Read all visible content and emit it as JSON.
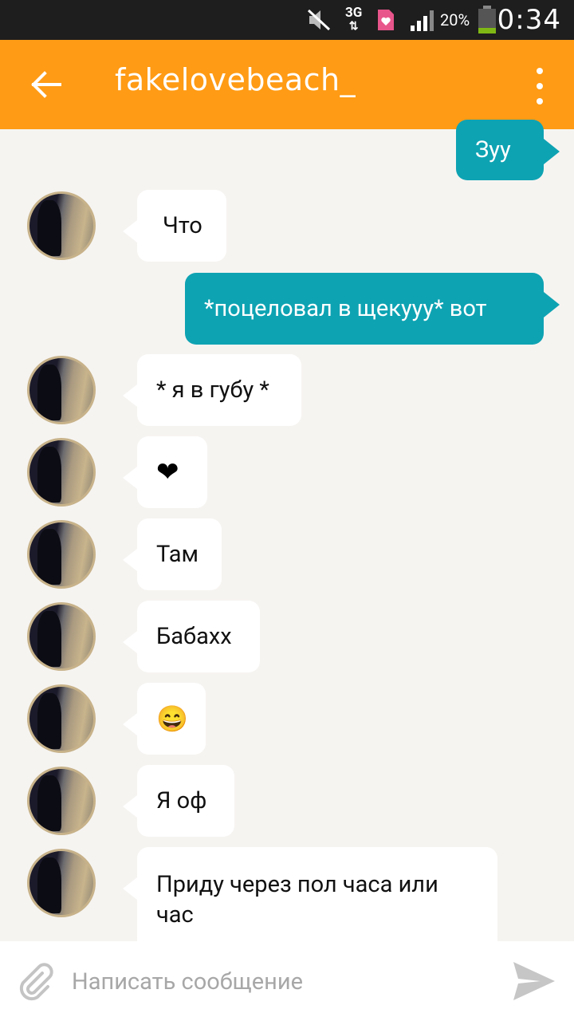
{
  "status_bar": {
    "network": "3G",
    "battery": "20%",
    "time": "0:34"
  },
  "app_bar": {
    "title": "fakelovebeach_"
  },
  "messages": [
    {
      "from": "me",
      "text": "Зуу"
    },
    {
      "from": "them",
      "text": "Что"
    },
    {
      "from": "me",
      "text": "*поцеловал в щекууу* вот"
    },
    {
      "from": "them",
      "text": "* я в губу *"
    },
    {
      "from": "them",
      "text": "❤"
    },
    {
      "from": "them",
      "text": "Там"
    },
    {
      "from": "them",
      "text": "Бабахх"
    },
    {
      "from": "them",
      "text": "😄"
    },
    {
      "from": "them",
      "text": "Я оф"
    },
    {
      "from": "them",
      "text": "Приду через пол часа или час"
    }
  ],
  "composer": {
    "placeholder": "Написать сообщение"
  },
  "colors": {
    "status_bar": "#1e1e1e",
    "app_bar": "#ff9b14",
    "outgoing_bubble": "#0ea3b3",
    "incoming_bubble": "#ffffff",
    "background": "#f6f4f1"
  }
}
